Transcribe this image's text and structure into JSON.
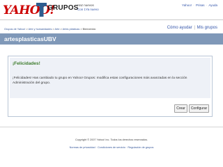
{
  "header": {
    "logo_text": "YAHOO!",
    "product_name": "GRUPOS",
    "tagline_1": "Haz nuevos",
    "tagline_2": "Con 1Ya nuevo",
    "top_links": [
      "Yahoo!",
      "Prisas",
      "Ayuda"
    ]
  },
  "breadcrumb": {
    "parts": [
      "Grupos de Yahoo!",
      "Arte y humanidades",
      "Arte",
      "Artes plásticas",
      "Bienvenido"
    ]
  },
  "language": {
    "options": [
      "Cómo ayudar",
      "Mis grupos"
    ]
  },
  "group": {
    "title": "artesplasticasUBV"
  },
  "notice": {
    "heading": "¡Felicidades!",
    "message": "¡Felicidades! Has cambiado tu grupo en Yahoo! Grupos: modifica estas configuraciones más avanzadas en la sección Administración del grupo.",
    "buttons": {
      "create": "Crear",
      "settings": "Configurar"
    }
  },
  "footer": {
    "copyright": "Copyright © 2007 Yahoo! Inc. Todos los derechos reservados.",
    "links": "Normas de privacidad · Condiciones de servicio · Regulación de grupos"
  },
  "colors": {
    "title_bar": "#7f98b8",
    "logo_red": "#cc0000",
    "heading_green": "#3b7a2a",
    "link_blue": "#3355aa"
  }
}
